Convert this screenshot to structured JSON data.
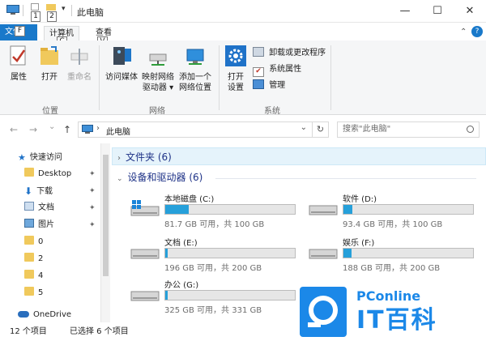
{
  "titlebar": {
    "title": "此电脑",
    "qa_keytips": [
      "1",
      "2"
    ],
    "minimize": "—",
    "maximize": "☐",
    "close": "✕"
  },
  "tabs": {
    "file": "文件",
    "file_keytip": "F",
    "computer": "计算机",
    "computer_keytip": "C",
    "view": "查看",
    "view_keytip": "V",
    "expand_chevron": "⌃",
    "help": "?"
  },
  "ribbon": {
    "location": {
      "label": "位置",
      "properties": "属性",
      "open": "打开",
      "rename": "重命名"
    },
    "network": {
      "label": "网络",
      "media": "访问媒体",
      "map_drive_1": "映射网络",
      "map_drive_2": "驱动器 ▾",
      "add_location_1": "添加一个",
      "add_location_2": "网络位置"
    },
    "system": {
      "label": "系统",
      "open_settings_1": "打开",
      "open_settings_2": "设置",
      "uninstall": "卸载或更改程序",
      "system_properties": "系统属性",
      "manage": "管理"
    }
  },
  "address": {
    "back": "←",
    "forward": "→",
    "dropdown": "⌄",
    "up": "↑",
    "path": "此电脑",
    "path_sep": "›",
    "path_dropdown": "⌄",
    "refresh": "↻",
    "search_placeholder": "搜索\"此电脑\""
  },
  "nav": {
    "quick_access": "快速访问",
    "items": [
      {
        "label": "Desktop",
        "pinned": true
      },
      {
        "label": "下载",
        "pinned": true
      },
      {
        "label": "文档",
        "pinned": true
      },
      {
        "label": "图片",
        "pinned": true
      },
      {
        "label": "0",
        "pinned": false
      },
      {
        "label": "2",
        "pinned": false
      },
      {
        "label": "4",
        "pinned": false
      },
      {
        "label": "5",
        "pinned": false
      }
    ],
    "onedrive": "OneDrive"
  },
  "content": {
    "folders_header": "文件夹 (6)",
    "devices_header": "设备和驱动器 (6)",
    "drives": [
      {
        "name": "本地磁盘 (C:)",
        "info": "81.7 GB 可用，共 100 GB",
        "used": 0.183,
        "windows": true
      },
      {
        "name": "软件 (D:)",
        "info": "93.4 GB 可用，共 100 GB",
        "used": 0.066,
        "windows": false
      },
      {
        "name": "文档 (E:)",
        "info": "196 GB 可用，共 200 GB",
        "used": 0.02,
        "windows": false
      },
      {
        "name": "娱乐 (F:)",
        "info": "188 GB 可用，共 200 GB",
        "used": 0.06,
        "windows": false
      },
      {
        "name": "办公 (G:)",
        "info": "325 GB 可用，共 331 GB",
        "used": 0.018,
        "windows": false
      }
    ]
  },
  "status": {
    "count": "12 个项目",
    "selected": "已选择 6 个项目"
  },
  "watermark": {
    "brand": "PConline",
    "sub": "IT百科"
  },
  "colors": {
    "accent": "#1979ca",
    "drive_fill": "#26a0da",
    "header_text": "#1e3287",
    "selected_bg": "#e5f3fb"
  }
}
